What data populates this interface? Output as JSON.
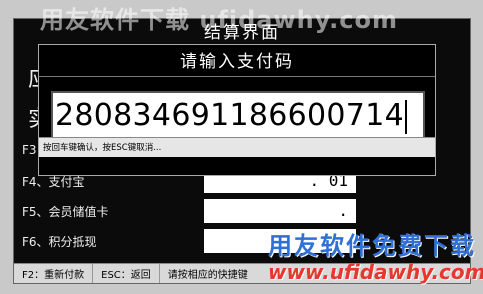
{
  "settlement": {
    "title": "结算界面",
    "side_chars": [
      "应",
      "实"
    ],
    "rows": [
      {
        "label": "F3",
        "value": ""
      },
      {
        "label": "F4、支付宝",
        "value": ". 01"
      },
      {
        "label": "F5、会员储值卡",
        "value": "."
      },
      {
        "label": "F6、积分抵现",
        "value": ""
      }
    ],
    "status_bar": {
      "item1": "F2：重新付款",
      "item2": "ESC：返回",
      "item3": "请按相应的快捷键"
    }
  },
  "dialog": {
    "title": "请输入支付码",
    "code_value": "280834691186600714",
    "hint": "按回车键确认，按ESC键取消..."
  },
  "watermark": {
    "top_text": "用友软件下载 ufidawhy.com",
    "logo_cn": "用友软件免费下载",
    "logo_url": "www.ufidawhy.com"
  }
}
